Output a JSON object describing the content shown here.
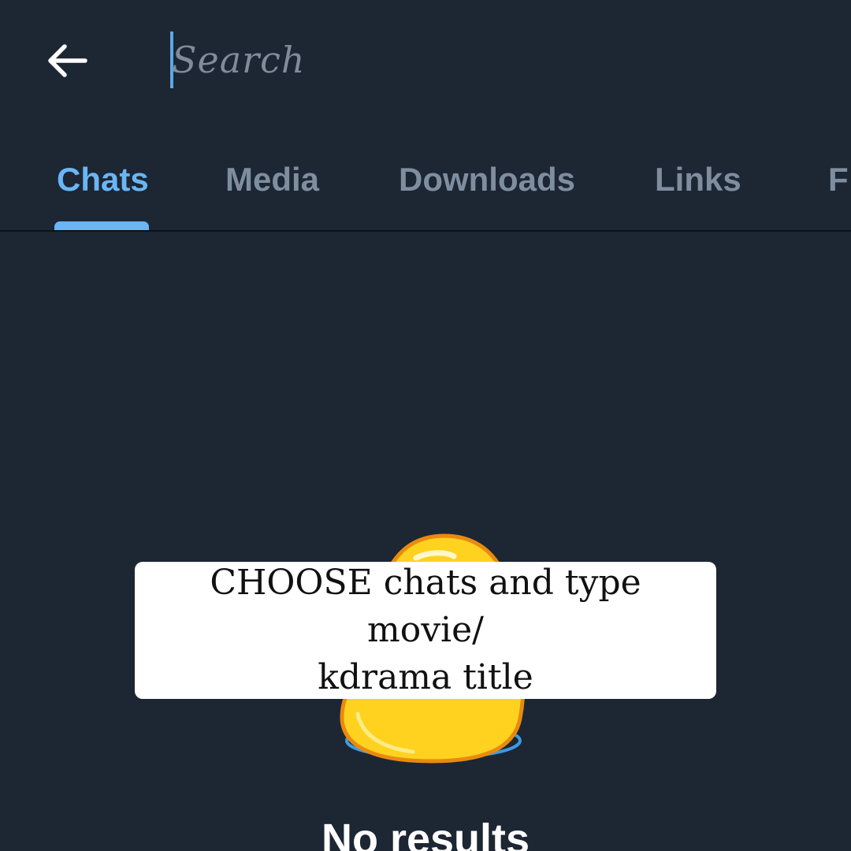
{
  "header": {
    "back_icon": "arrow-left-icon",
    "search": {
      "placeholder": "Search",
      "value": ""
    }
  },
  "tabs": [
    {
      "label": "Chats",
      "active": true
    },
    {
      "label": "Media",
      "active": false
    },
    {
      "label": "Downloads",
      "active": false
    },
    {
      "label": "Links",
      "active": false
    },
    {
      "label": "F",
      "active": false
    }
  ],
  "empty_state": {
    "sticker_icon": "yellow-blob-sticker-icon",
    "message": "No results"
  },
  "overlay": {
    "line1": "CHOOSE chats and type movie/",
    "line2": "kdrama title"
  },
  "colors": {
    "background": "#1d2633",
    "accent": "#6ab6f5",
    "tab_inactive": "#7e8e9f",
    "caret": "#5ea6e6",
    "sticker_yellow": "#ffd21f"
  }
}
